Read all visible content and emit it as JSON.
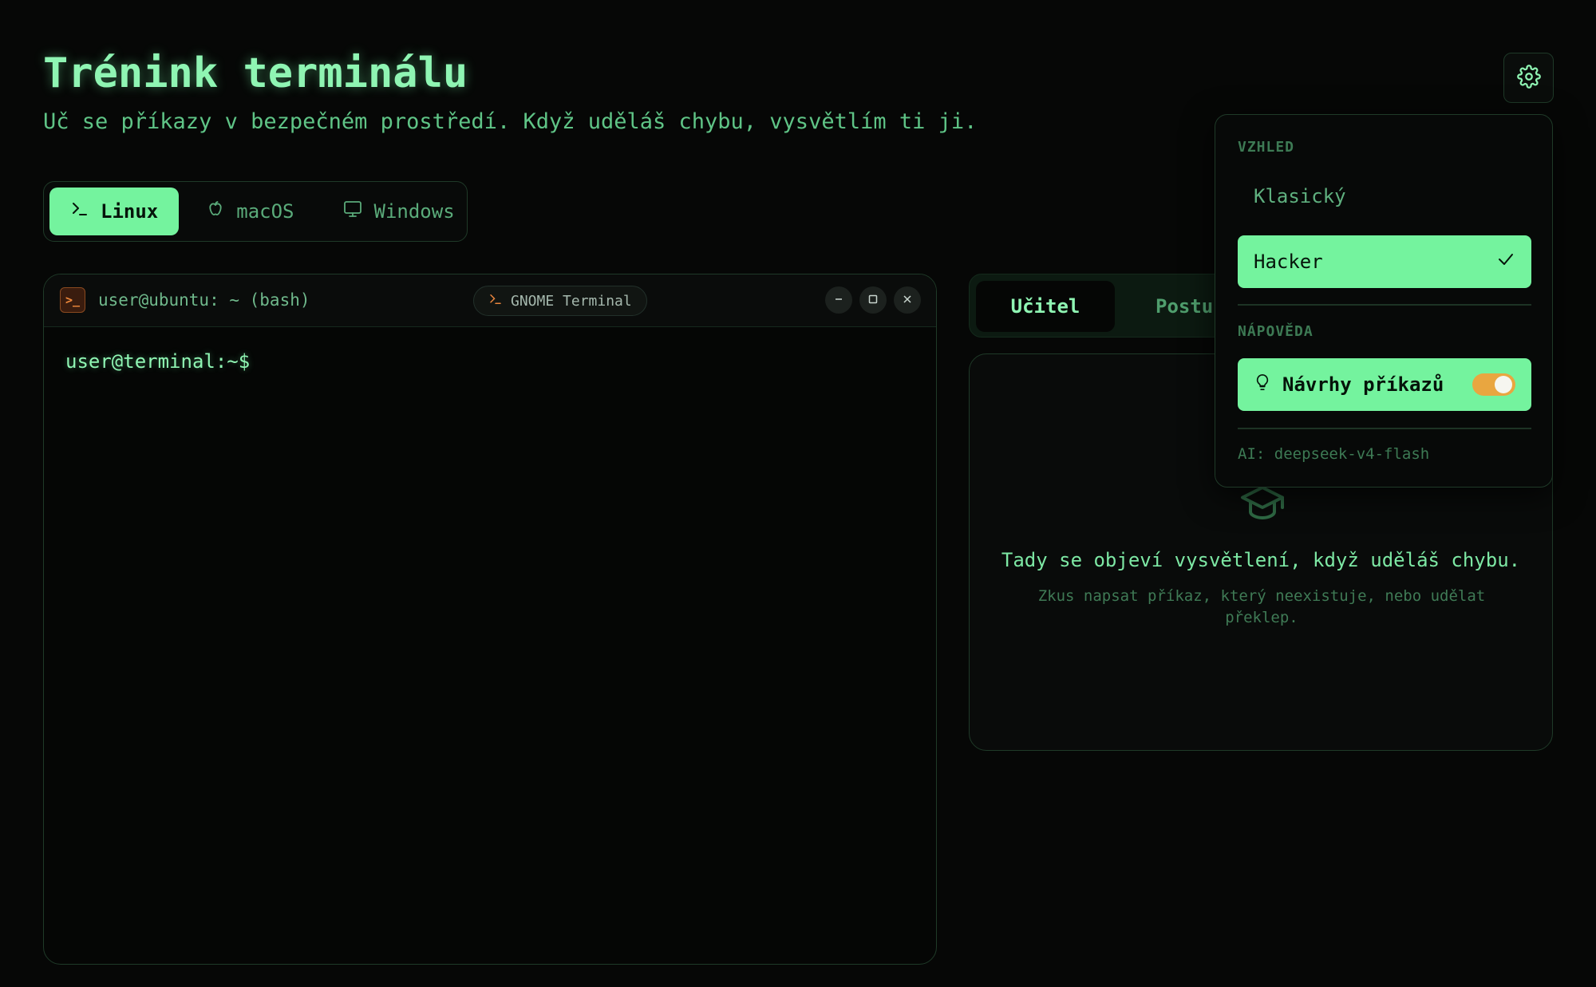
{
  "header": {
    "title": "Trénink terminálu",
    "subtitle": "Uč se příkazy v bezpečném prostředí. Když uděláš chybu, vysvětlím ti ji."
  },
  "os_tabs": [
    {
      "label": "Linux",
      "icon": "terminal-icon",
      "active": true
    },
    {
      "label": "macOS",
      "icon": "apple-icon",
      "active": false
    },
    {
      "label": "Windows",
      "icon": "monitor-icon",
      "active": false
    }
  ],
  "terminal": {
    "title": "user@ubuntu: ~ (bash)",
    "app_name": "GNOME Terminal",
    "prompt": "user@terminal:~$",
    "icon_text": ">_"
  },
  "side_tabs": [
    {
      "label": "Učitel",
      "active": true
    },
    {
      "label": "Postup",
      "active": false
    }
  ],
  "teacher": {
    "message": "Tady se objeví vysvětlení, když uděláš chybu.",
    "hint": "Zkus napsat příkaz, který neexistuje, nebo udělat překlep."
  },
  "settings_menu": {
    "appearance_header": "VZHLED",
    "themes": [
      {
        "label": "Klasický",
        "selected": false
      },
      {
        "label": "Hacker",
        "selected": true
      }
    ],
    "help_header": "NÁPOVĚDA",
    "suggestions_label": "Návrhy příkazů",
    "suggestions_enabled": true,
    "ai_model": "AI: deepseek-v4-flash"
  },
  "colors": {
    "accent": "#74f39e",
    "background": "#060706",
    "toggle_on": "#e9a640"
  }
}
